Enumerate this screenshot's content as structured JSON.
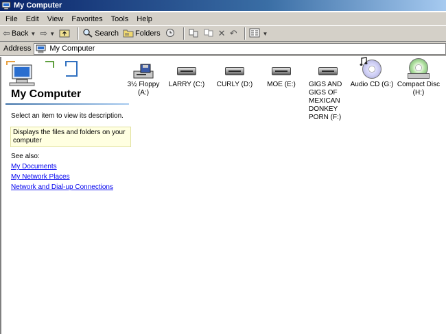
{
  "window": {
    "title": "My Computer"
  },
  "menu": [
    "File",
    "Edit",
    "View",
    "Favorites",
    "Tools",
    "Help"
  ],
  "toolbar": {
    "back": "Back",
    "search": "Search",
    "folders": "Folders"
  },
  "address": {
    "label": "Address",
    "value": "My Computer"
  },
  "sidebar": {
    "title": "My Computer",
    "description": "Select an item to view its description.",
    "info": "Displays the files and folders on your computer",
    "see_also_label": "See also:",
    "links": [
      "My Documents",
      "My Network Places",
      "Network and Dial-up Connections"
    ]
  },
  "drives": [
    {
      "name": "3½ Floppy (A:)",
      "icon": "floppy-drive-icon"
    },
    {
      "name": "LARRY (C:)",
      "icon": "hard-drive-icon"
    },
    {
      "name": "CURLY (D:)",
      "icon": "hard-drive-icon"
    },
    {
      "name": "MOE (E:)",
      "icon": "hard-drive-icon"
    },
    {
      "name": "GIGS AND GIGS OF MEXICAN DONKEY PORN (F:)",
      "icon": "hard-drive-icon"
    },
    {
      "name": "Audio CD (G:)",
      "icon": "audio-cd-icon"
    },
    {
      "name": "Compact Disc (H:)",
      "icon": "compact-disc-icon"
    }
  ]
}
